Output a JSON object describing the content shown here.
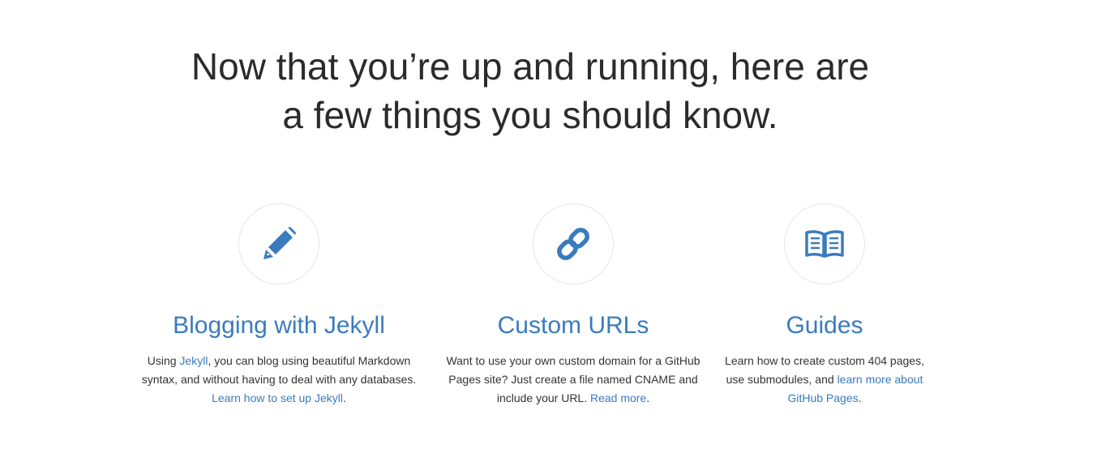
{
  "headline": {
    "line1": "Now that you’re up and running, here are",
    "line2": "a few things you should know."
  },
  "accent_color": "#3a7bbf",
  "features": [
    {
      "icon": "pencil-icon",
      "title": "Blogging with Jekyll",
      "text_1": "Using ",
      "link_1": "Jekyll",
      "text_2": ", you can blog using beautiful Markdown syntax, and without having to deal with any databases. ",
      "link_2": "Learn how to set up Jekyll",
      "text_3": "."
    },
    {
      "icon": "link-icon",
      "title": "Custom URLs",
      "text_1": "Want to use your own custom domain for a GitHub Pages site? Just create a file named CNAME and include your URL. ",
      "link_1": "Read more",
      "text_2": "."
    },
    {
      "icon": "book-icon",
      "title": "Guides",
      "text_1": "Learn how to create custom 404 pages, use submodules, and ",
      "link_1": "learn more about GitHub Pages",
      "text_2": "."
    }
  ]
}
